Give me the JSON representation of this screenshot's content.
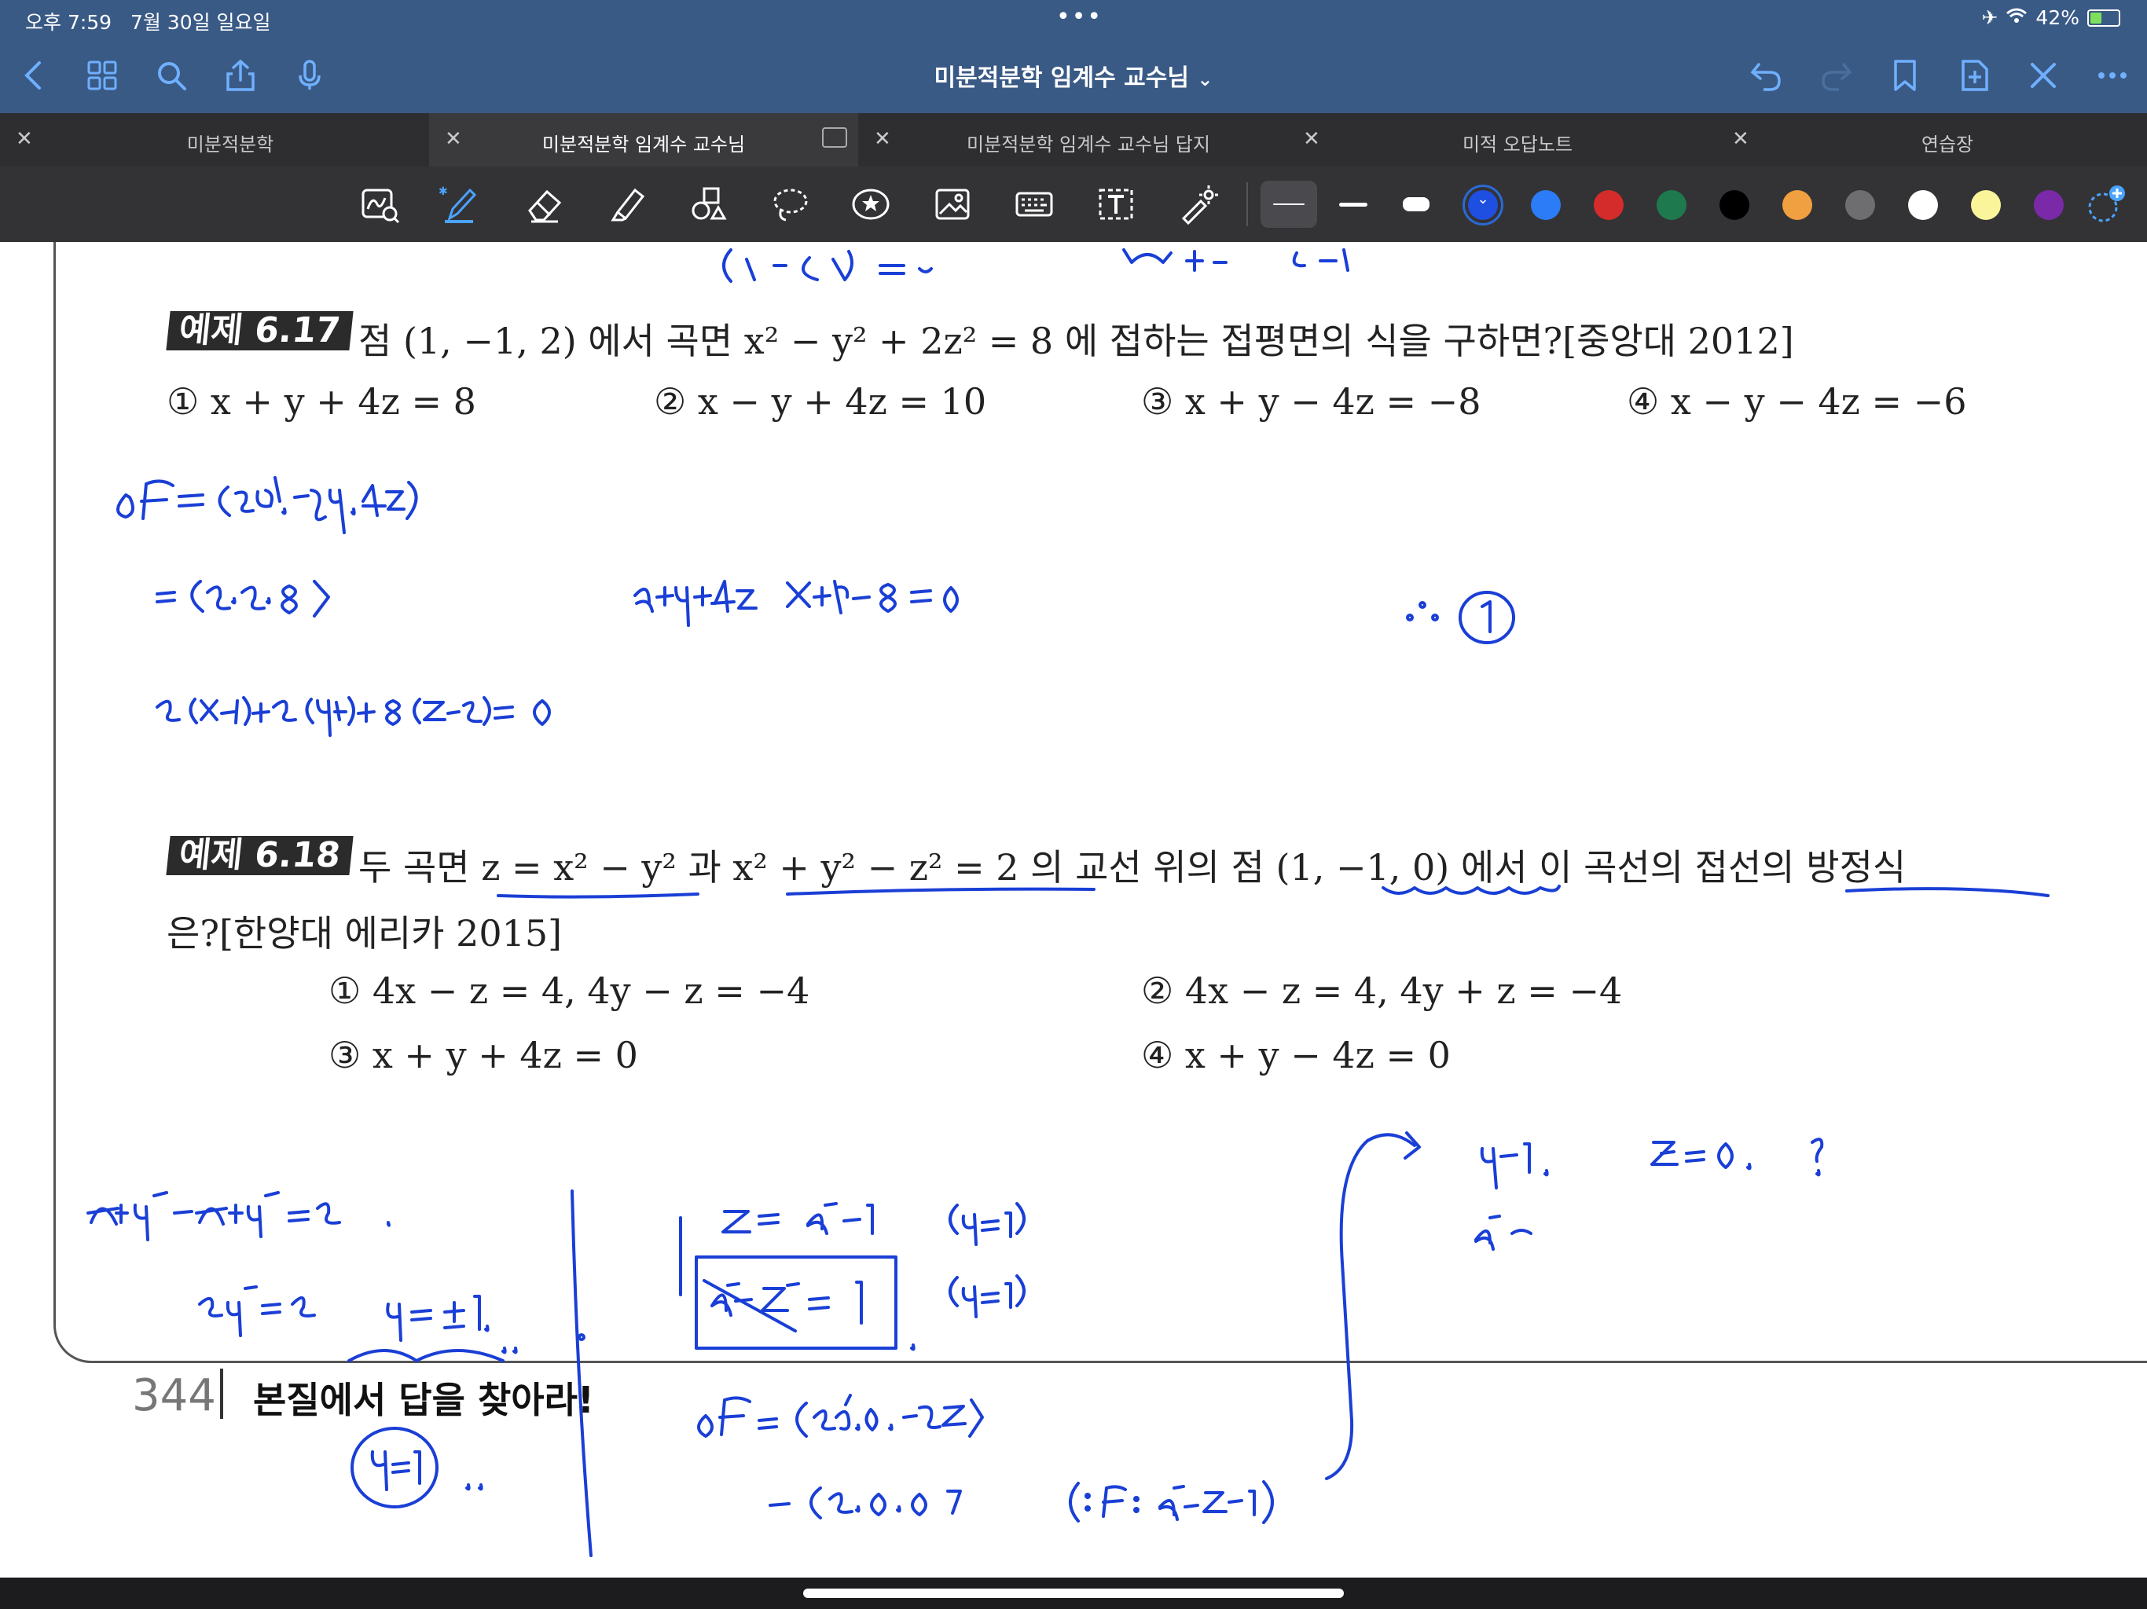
{
  "status_bar": {
    "time": "오후 7:59",
    "date": "7월 30일 일요일",
    "dots": "•••",
    "battery": "42%",
    "battery_level": 0.42
  },
  "nav": {
    "title": "미분적분학 임계수 교수님",
    "title_chevron": "⌄"
  },
  "tabs": [
    {
      "label": "미분적분학"
    },
    {
      "label": "미분적분학 임계수 교수님"
    },
    {
      "label": "미분적분학 임계수 교수님 답지"
    },
    {
      "label": "미적 오답노트"
    },
    {
      "label": "연습장"
    }
  ],
  "colors": {
    "header_bg": "#3a5a86",
    "accent": "#6fb0ff",
    "ink": "#1a3fd6",
    "swatches": [
      "#1f4fe0",
      "#2b7cf6",
      "#d42b2b",
      "#1e7a4e",
      "#000000",
      "#f0a040",
      "#6e6e70",
      "#ffffff",
      "#faf59a",
      "#7a2aa8"
    ]
  },
  "document": {
    "p617": {
      "label": "예제 6.17",
      "text": "점 (1, −1, 2) 에서 곡면 x² − y² + 2z² = 8 에 접하는 접평면의 식을 구하면?[중앙대 2012]",
      "choices": [
        "① x + y + 4z = 8",
        "② x − y + 4z = 10",
        "③ x + y − 4z = −8",
        "④ x − y − 4z = −6"
      ]
    },
    "p618": {
      "label": "예제 6.18",
      "line1": "두 곡면 z = x² − y² 과 x² + y² − z² = 2 의 교선 위의 점 (1, −1, 0) 에서 이 곡선의 접선의 방정식",
      "line2": "은?[한양대 에리카 2015]",
      "choices": [
        "① 4x − z = 4,  4y − z = −4",
        "② 4x − z = 4,  4y + z = −4",
        "③ x + y + 4z = 0",
        "④ x + y − 4z = 0"
      ]
    },
    "page_number": "344",
    "slogan": "본질에서 답을 찾아라!"
  }
}
